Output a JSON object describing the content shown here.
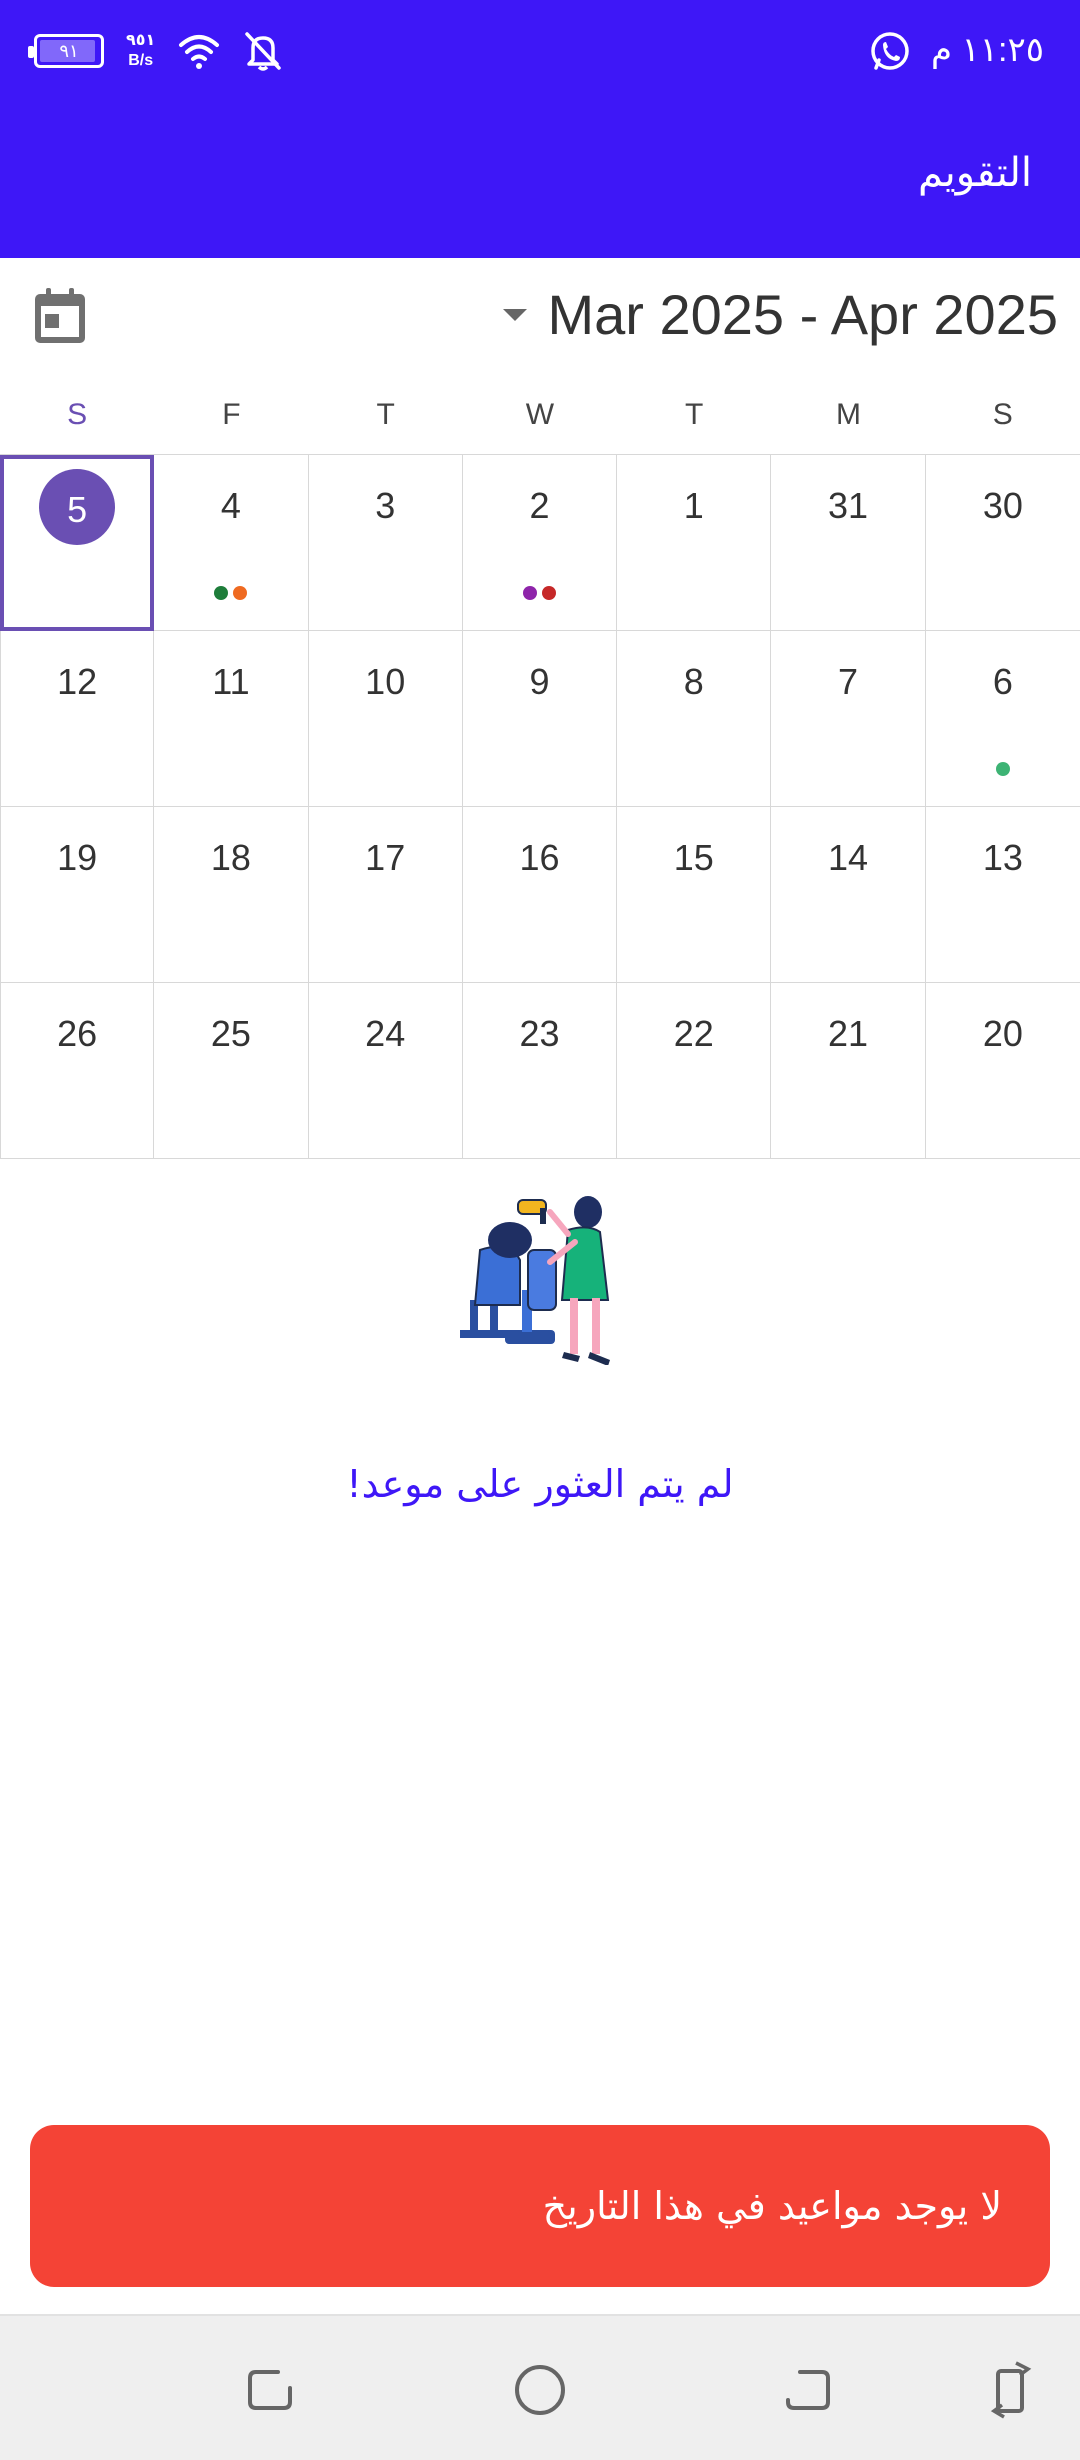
{
  "status_bar": {
    "time": "١١:٢٥ م",
    "battery": "٩١",
    "net_speed_value": "٩٥١",
    "net_speed_unit": "B/s"
  },
  "app_bar": {
    "title": "التقويم"
  },
  "calendar": {
    "range_label": "Mar 2025 - Apr 2025",
    "weekdays": [
      "S",
      "F",
      "T",
      "W",
      "T",
      "M",
      "S"
    ],
    "weeks": [
      [
        "5",
        "4",
        "3",
        "2",
        "1",
        "31",
        "30"
      ],
      [
        "12",
        "11",
        "10",
        "9",
        "8",
        "7",
        "6"
      ],
      [
        "19",
        "18",
        "17",
        "16",
        "15",
        "14",
        "13"
      ],
      [
        "26",
        "25",
        "24",
        "23",
        "22",
        "21",
        "20"
      ]
    ],
    "selected_day": "5",
    "event_dots": {
      "4": [
        "#1e7d3a",
        "#ef6a21"
      ],
      "2": [
        "#8e24aa",
        "#c62828"
      ],
      "6": [
        "#3db374"
      ]
    },
    "accent_color": "#6a4fb3"
  },
  "empty_state": {
    "message": "لم يتم العثور على موعد!"
  },
  "snackbar": {
    "message": "لا يوجد مواعيد في هذا التاريخ",
    "color": "#f44336"
  },
  "colors": {
    "primary": "#3e17f7"
  }
}
